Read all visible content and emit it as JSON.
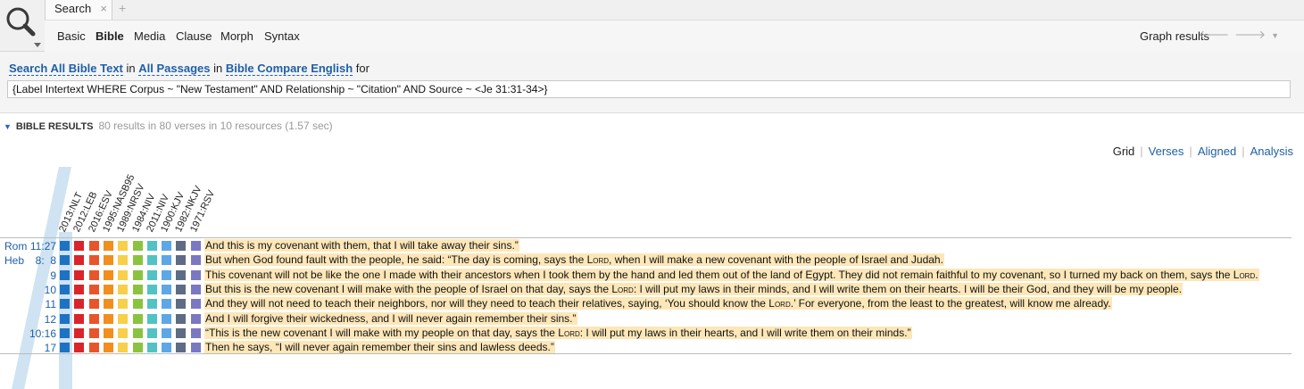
{
  "tab": {
    "label": "Search",
    "close": "×",
    "add": "+"
  },
  "subtabs": [
    "Basic",
    "Bible",
    "Media",
    "Clause",
    "Morph",
    "Syntax"
  ],
  "active_subtab": "Bible",
  "graph_results": "Graph results",
  "nav": {
    "back": "🡐",
    "forward": "🡒",
    "menu": "▼"
  },
  "query": {
    "scope_1": "Search All Bible Text",
    "in_1": "in",
    "scope_2": "All Passages",
    "in_2": "in",
    "scope_3": "Bible Compare English",
    "for": "for",
    "text": "{Label Intertext WHERE Corpus ~ \"New Testament\" AND Relationship ~ \"Citation\" AND Source ~ <Je 31:31-34>}"
  },
  "results": {
    "heading": "BIBLE RESULTS",
    "meta": "80 results in 80 verses in 10 resources (1.57 sec)"
  },
  "views": [
    "Grid",
    "Verses",
    "Aligned",
    "Analysis"
  ],
  "active_view": "Grid",
  "columns": [
    {
      "label": "2013:NLT",
      "color": "#1e72c4"
    },
    {
      "label": "2012:LEB",
      "color": "#d9242b"
    },
    {
      "label": "2016:ESV",
      "color": "#e8552b"
    },
    {
      "label": "1995:NASB95",
      "color": "#f28e1e"
    },
    {
      "label": "1989:NRSV",
      "color": "#f7cf4a"
    },
    {
      "label": "1984:NIV",
      "color": "#8ac43f"
    },
    {
      "label": "2011:NIV",
      "color": "#52c2c4"
    },
    {
      "label": "1900:KJV",
      "color": "#5ea7e6"
    },
    {
      "label": "1982:NKJV",
      "color": "#5d6b85"
    },
    {
      "label": "1971:RSV",
      "color": "#7b78c2"
    }
  ],
  "rows": [
    {
      "book": "Rom",
      "ch": "11:27",
      "pre": "And this is my covenant with them, that I will take away their sins.”",
      "lord": "",
      "post": ""
    },
    {
      "book": "Heb",
      "ch": "8:  8",
      "pre": "But when God found fault with the people, he said: “The day is coming, says the ",
      "lord": "Lord",
      "post": ", when I will make a new covenant with the people of Israel and Judah."
    },
    {
      "book": "",
      "ch": "9",
      "pre": "This covenant will not be like the one I made with their ancestors when I took them by the hand and led them out of the land of Egypt. They did not remain faithful to my covenant, so I turned my back on them, says the ",
      "lord": "Lord",
      "post": "."
    },
    {
      "book": "",
      "ch": "10",
      "pre": "But this is the new covenant I will make with the people of Israel on that day, says the ",
      "lord": "Lord",
      "post": ": I will put my laws in their minds, and I will write them on their hearts. I will be their God, and they will be my people."
    },
    {
      "book": "",
      "ch": "11",
      "pre": "And they will not need to teach their neighbors, nor will they need to teach their relatives, saying, ‘You should know the ",
      "lord": "Lord",
      "post": ".’ For everyone, from the least to the greatest, will know me already."
    },
    {
      "book": "",
      "ch": "12",
      "pre": "And I will forgive their wickedness, and I will never again remember their sins.”",
      "lord": "",
      "post": ""
    },
    {
      "book": "",
      "ch": "10:16",
      "pre": "“This is the new covenant I will make with my people on that day, says the ",
      "lord": "Lord",
      "post": ": I will put my laws in their hearts, and I will write them on their minds.”"
    },
    {
      "book": "",
      "ch": "17",
      "pre": "Then he says, “I will never again remember their sins and lawless deeds.”",
      "lord": "",
      "post": ""
    }
  ]
}
